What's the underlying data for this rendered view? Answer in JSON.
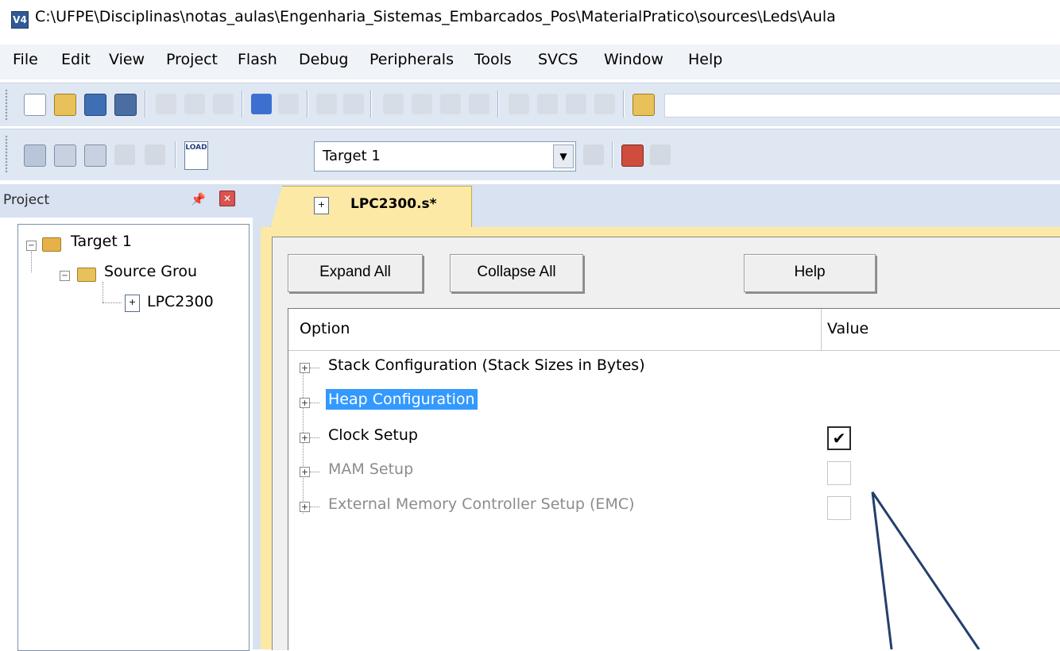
{
  "window": {
    "title": "C:\\UFPE\\Disciplinas\\notas_aulas\\Engenharia_Sistemas_Embarcados_Pos\\MaterialPratico\\sources\\Leds\\Aula",
    "app_icon_text": "V4"
  },
  "menu": {
    "items": [
      "File",
      "Edit",
      "View",
      "Project",
      "Flash",
      "Debug",
      "Peripherals",
      "Tools",
      "SVCS",
      "Window",
      "Help"
    ]
  },
  "toolbar": {
    "target_value": "Target 1",
    "load_icon_text": "LOAD"
  },
  "project_pane": {
    "title": "Project",
    "tree": {
      "target": "Target 1",
      "group": "Source Grou",
      "file": "LPC2300"
    }
  },
  "editor": {
    "tab_label": "LPC2300.s*",
    "buttons": {
      "expand": "Expand All",
      "collapse": "Collapse All",
      "help": "Help"
    },
    "grid": {
      "headers": {
        "option": "Option",
        "value": "Value"
      },
      "rows": [
        {
          "label": "Stack Configuration (Stack Sizes in Bytes)",
          "state": "normal",
          "checkbox": null
        },
        {
          "label": "Heap Configuration",
          "state": "selected",
          "checkbox": null
        },
        {
          "label": "Clock Setup",
          "state": "normal",
          "checkbox": true
        },
        {
          "label": "MAM Setup",
          "state": "disabled",
          "checkbox": false
        },
        {
          "label": "External Memory Controller Setup (EMC)",
          "state": "disabled",
          "checkbox": false
        }
      ]
    }
  },
  "colors": {
    "accent_selection": "#3399ff",
    "tab_background": "#fde9a6",
    "toolbar_background": "#dfe7f3",
    "annotation_arrow": "#243f6b"
  },
  "icons": {
    "checkmark": "✔"
  }
}
